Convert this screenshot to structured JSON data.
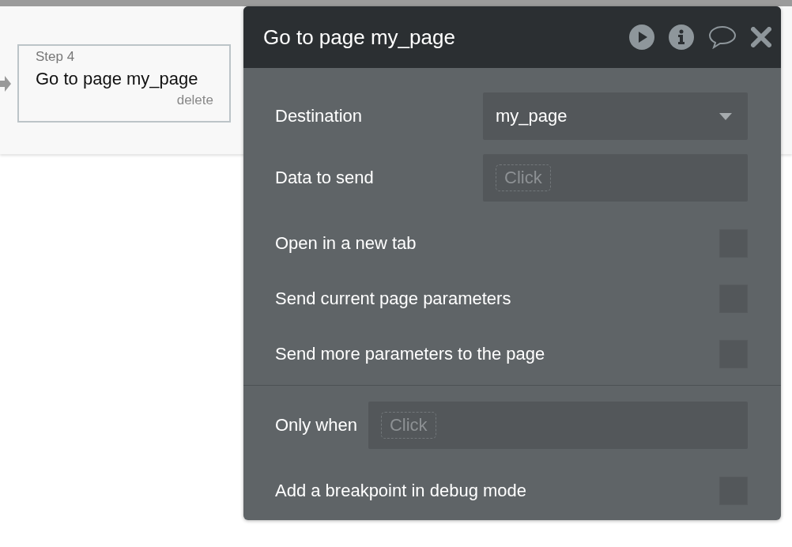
{
  "step_card": {
    "step": "Step 4",
    "title": "Go to page my_page",
    "delete": "delete"
  },
  "panel": {
    "title": "Go to page my_page",
    "sections": [
      {
        "rows": [
          {
            "kind": "dropdown",
            "label": "Destination",
            "value": "my_page"
          },
          {
            "kind": "expression",
            "label": "Data to send",
            "placeholder": "Click"
          },
          {
            "kind": "checkbox",
            "label": "Open in a new tab",
            "checked": false
          },
          {
            "kind": "checkbox",
            "label": "Send current page parameters",
            "checked": false
          },
          {
            "kind": "checkbox",
            "label": "Send more parameters to the page",
            "checked": false
          }
        ]
      },
      {
        "rows": [
          {
            "kind": "condition",
            "label": "Only when",
            "placeholder": "Click"
          },
          {
            "kind": "checkbox",
            "label": "Add a breakpoint in debug mode",
            "checked": false
          }
        ]
      }
    ]
  }
}
